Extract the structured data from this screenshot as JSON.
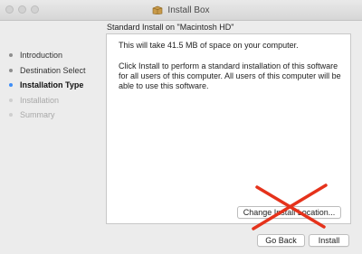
{
  "window": {
    "title": "Install Box",
    "icon": "package-icon"
  },
  "sidebar": {
    "steps": [
      {
        "label": "Introduction",
        "state": "done"
      },
      {
        "label": "Destination Select",
        "state": "done"
      },
      {
        "label": "Installation Type",
        "state": "current"
      },
      {
        "label": "Installation",
        "state": "future"
      },
      {
        "label": "Summary",
        "state": "future"
      }
    ]
  },
  "main": {
    "heading": "Standard Install on \"Macintosh HD\"",
    "paragraph1": "This will take 41.5 MB of space on your computer.",
    "paragraph2": "Click Install to perform a standard installation of this software for all users of this computer. All users of this computer will be able to use this software.",
    "change_location_label": "Change Install Location..."
  },
  "buttons": {
    "go_back": "Go Back",
    "install": "Install"
  },
  "annotation": {
    "mark": "red-x-icon",
    "color": "#e5321b"
  },
  "colors": {
    "current_step_dot": "#3e8ef7",
    "window_bg": "#ececec"
  }
}
